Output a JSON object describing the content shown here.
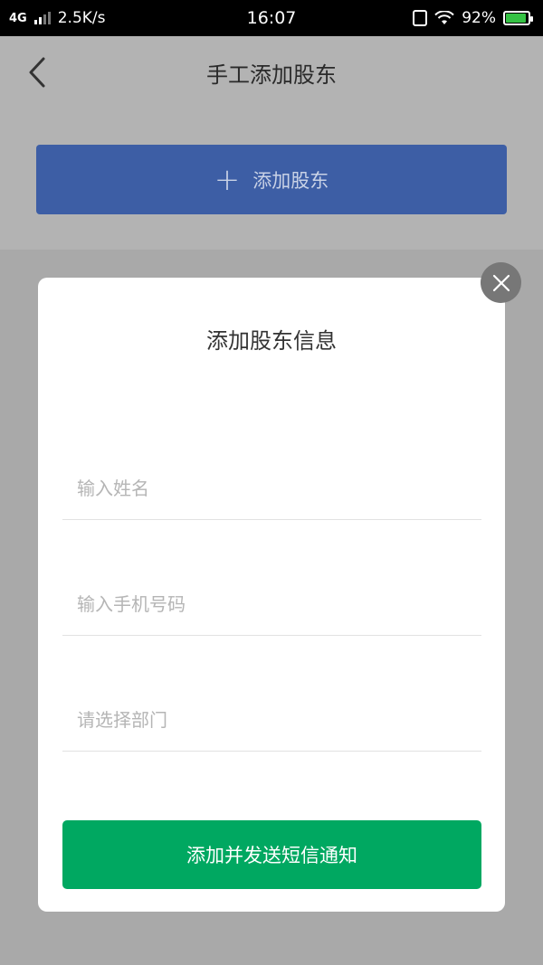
{
  "status_bar": {
    "network": "4G",
    "speed": "2.5K/s",
    "time": "16:07",
    "battery": "92%",
    "battery_color": "#35c244"
  },
  "header": {
    "title": "手工添加股东",
    "back_icon": "chevron-left-icon"
  },
  "add_shareholder": {
    "label": "添加股东",
    "icon": "plus-icon",
    "color": "#3d5ea5"
  },
  "modal": {
    "title": "添加股东信息",
    "name_placeholder": "输入姓名",
    "phone_placeholder": "输入手机号码",
    "department_placeholder": "请选择部门",
    "submit_label": "添加并发送短信通知",
    "submit_color": "#00a861",
    "close_icon": "close-icon"
  }
}
